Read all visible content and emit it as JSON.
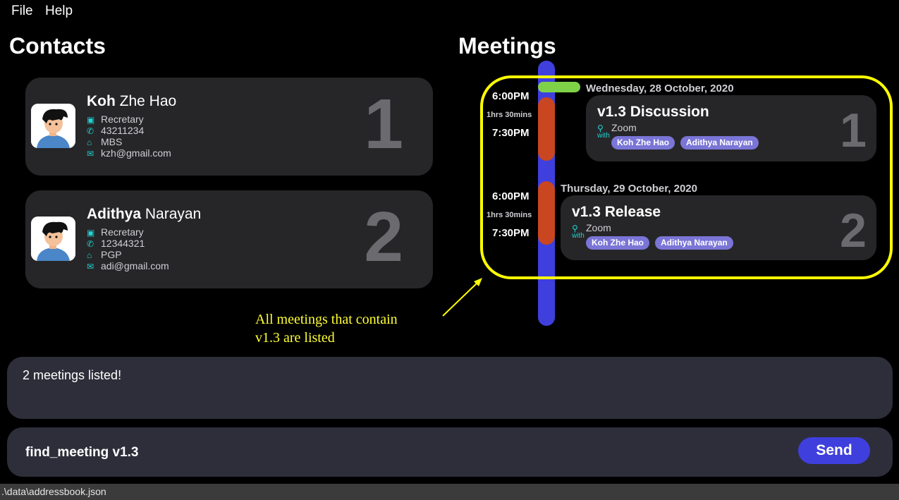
{
  "menu": {
    "file": "File",
    "help": "Help"
  },
  "contacts": {
    "title": "Contacts",
    "items": [
      {
        "first": "Koh",
        "last": " Zhe Hao",
        "company": "Recretary",
        "phone": "43211234",
        "address": "MBS",
        "email": "kzh@gmail.com",
        "index": "1"
      },
      {
        "first": "Adithya",
        "last": " Narayan",
        "company": "Recretary",
        "phone": "12344321",
        "address": "PGP",
        "email": "adi@gmail.com",
        "index": "2"
      }
    ]
  },
  "meetings": {
    "title": "Meetings",
    "items": [
      {
        "date": "Wednesday, 28 October, 2020",
        "start": "6:00PM",
        "duration": "1hrs 30mins",
        "end": "7:30PM",
        "title": "v1.3 Discussion",
        "location": "Zoom",
        "with_label": "with",
        "participants": [
          "Koh Zhe Hao",
          "Adithya Narayan"
        ],
        "index": "1"
      },
      {
        "date": "Thursday, 29 October, 2020",
        "start": "6:00PM",
        "duration": "1hrs 30mins",
        "end": "7:30PM",
        "title": "v1.3 Release",
        "location": "Zoom",
        "with_label": "with",
        "participants": [
          "Koh Zhe Hao",
          "Adithya Narayan"
        ],
        "index": "2"
      }
    ]
  },
  "annotation": {
    "line1": "All meetings that contain",
    "line2": "v1.3 are listed"
  },
  "result": {
    "text": "2 meetings listed!"
  },
  "command": {
    "value": "find_meeting v1.3",
    "send_label": "Send"
  },
  "status": {
    "path": ".\\data\\addressbook.json"
  },
  "colors": {
    "accent": "#3f3fde",
    "highlight": "#ffff00",
    "meeting_block": "#c94620",
    "today": "#7fd248",
    "tag": "#7a75d6",
    "icon": "#1fd3d3"
  },
  "icons": {
    "company": "briefcase-icon",
    "phone": "phone-icon",
    "address": "home-icon",
    "email": "mail-icon",
    "location": "location-pin-icon"
  }
}
